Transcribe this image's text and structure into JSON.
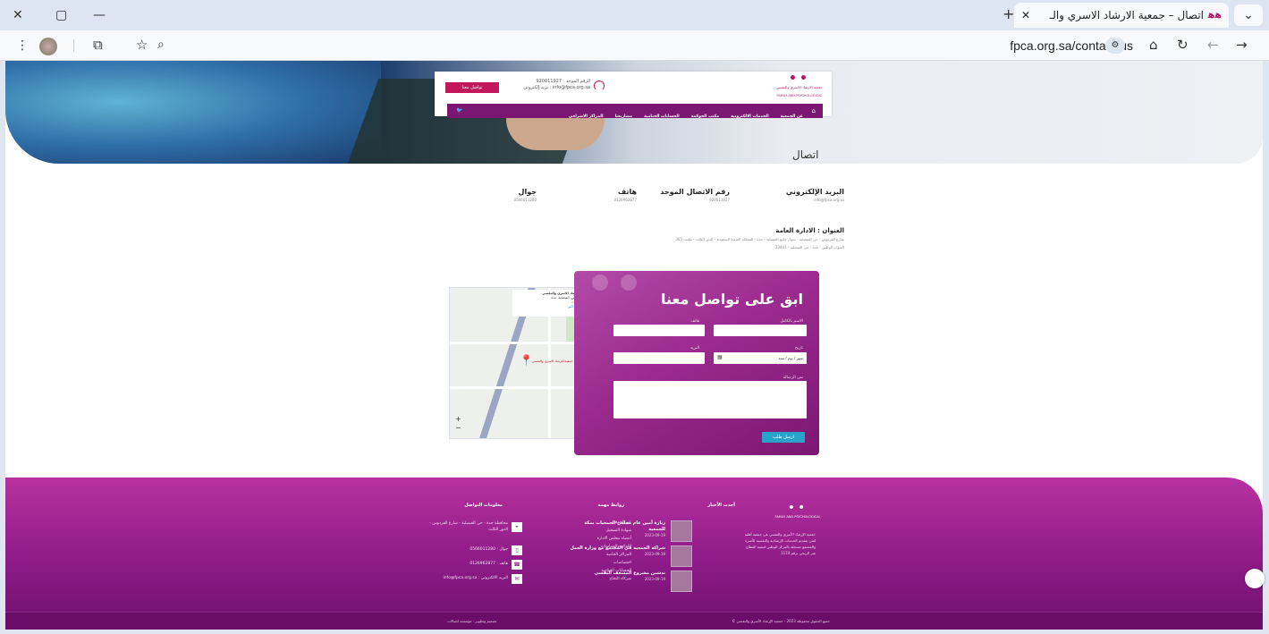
{
  "browser": {
    "tab_title": "اتصال – جمعية الارشاد الاسري والـ",
    "tab_logo": "ﻫﻫ",
    "close_tab": "✕",
    "new_tab": "+",
    "window_close": "✕",
    "window_restore": "▢",
    "window_min": "—",
    "tab_search": "⌄",
    "url": "fpca.org.sa/contact-us"
  },
  "header": {
    "logo_name": "جمعية الارشاد الاسري والنفسي",
    "logo_en": "FAMILY AND PSYCHOLOGICAL",
    "hotline": "الرقم الموحد : 920011927",
    "email_line": "بريد إلكتروني : info@fpca.org.sa",
    "contact_btn": "تواصل معنا",
    "menu": [
      "عن الجمعية",
      "الخدمات الالكترونية",
      "مكتب الحوكمة",
      "الحسابات الختامية",
      "مشاريعنا",
      "المراكز الاشرافي"
    ],
    "page_title": "اتصال"
  },
  "info": {
    "email_label": "البريد الإلكتروني",
    "email_value": "info@fpca.org.sa",
    "unified_label": "رقم الاتصال الموحد",
    "unified_value": "920011927",
    "phone_label": "هاتف",
    "phone_value": "0126962877",
    "mobile_label": "جوال",
    "mobile_value": "0566011280",
    "address_label": "العنوان : الادارة العامة",
    "address_line1": "شارع الفردوس - حي الفيصلية - بجوار جامع الفيصلية - جدة - المملكة العربية السعودية - الدور الثالث - مكتب 305",
    "address_line2": "العنوان الوطني : جدة - حي الفيصلية - 23441"
  },
  "map": {
    "card_title": "جمعية الارشاد الاسري والنفسي",
    "card_sub": "شارع الفردوس، الفيصلية، جدة",
    "card_rating": "4.6 ★★★★★",
    "card_link": "عرض خريطة أكبر",
    "pin_label": "جمعية الارشاد الاسري والنفسي",
    "zoom_in": "+",
    "zoom_out": "−"
  },
  "form": {
    "title": "ابق على تواصل معنا",
    "name_label": "الاسم بالكامل",
    "mobile_label": "هاتف",
    "date_label": "تاريخ",
    "date_placeholder": "شهر / يوم / سنة",
    "email_label": "البريد",
    "message_label": "نص الرسالة",
    "submit": "ارسل طلب"
  },
  "footer": {
    "about": "جمعية الإرشاد الأسري والنفسي هي جمعية أهلية تُعنى بتقديم الخدمات الإرشادية والنفسية للأسرة والمجتمع مسجلة بالمركز الوطني لتنمية القطاع غير الربحي برقم 1174",
    "news_title": "أحدث الأخبار",
    "news": [
      {
        "title": "زيارة أمين عام مجلس الجمعيات بمكة للجمعية",
        "date": "2023-09-19"
      },
      {
        "title": "شراكة الجمعية في المجتمع مع وزارة العمل",
        "date": "2023-09-19"
      },
      {
        "title": "تدشين مشروع المسعف النفسي",
        "date": "2023-09-19"
      }
    ],
    "links_title": "روابط مهمة",
    "links": [
      "عن الجمعية",
      "شهادة التسجيل",
      "أعضاء مجلس الادارة",
      "اللوائح والسياسات",
      "المراكز الخاصة",
      "اختصاصات",
      "الحسابات الختامية",
      "شركاء النجاح"
    ],
    "contact_title": "معلومات التواصل",
    "contact": [
      "محافظة جدة - حي الفيصلية - شارع الفردوس - الدور الثالث",
      "جوال : 0566011280",
      "هاتف : 0126962877",
      "info@fpca.org.sa : البريد الالكتروني"
    ],
    "copyright": "© جميع الحقوق محفوظة 2023 - جمعية الإرشاد الأسري والنفسي",
    "credit": "تصميم وتطوير : مؤسسة اتصالات"
  }
}
